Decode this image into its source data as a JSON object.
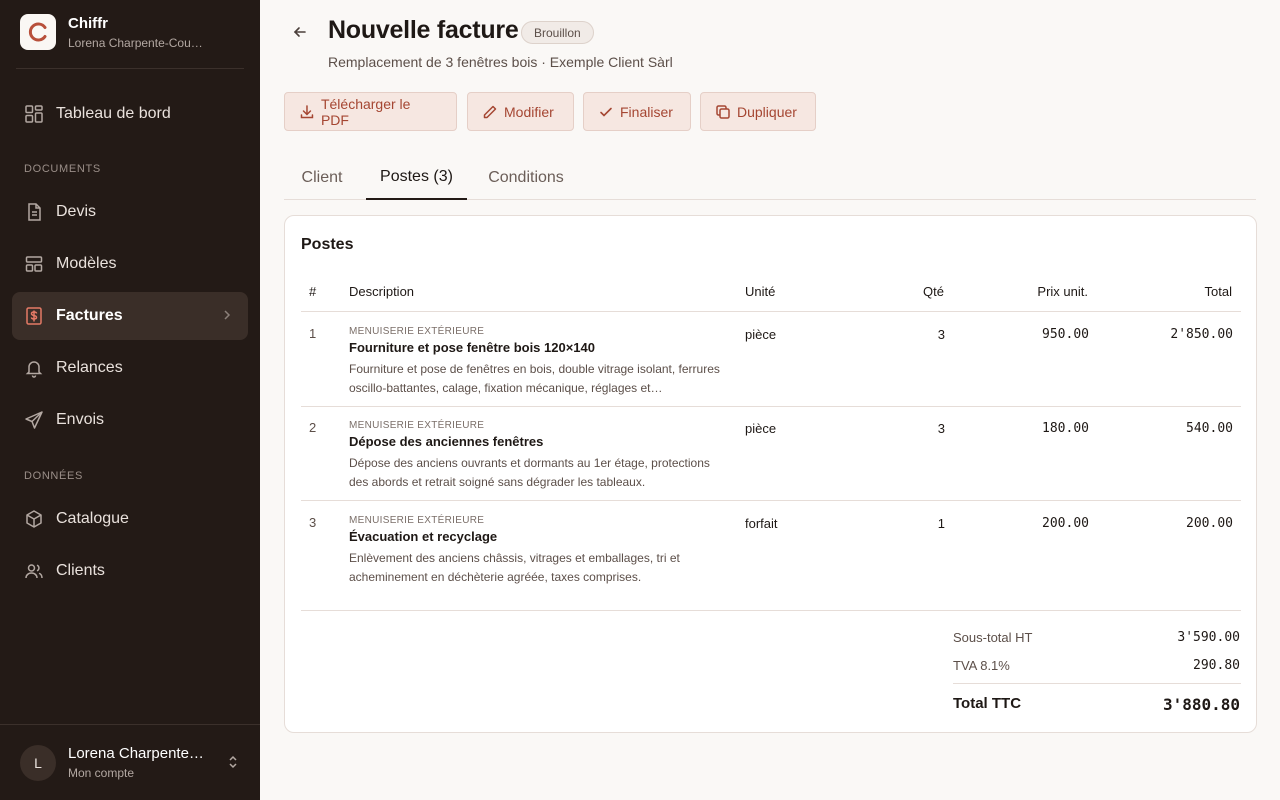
{
  "brand": {
    "name": "Chiffr",
    "subtitle": "Lorena Charpente-Couve…"
  },
  "sidebar": {
    "dashboard": "Tableau de bord",
    "section_documents": "DOCUMENTS",
    "devis": "Devis",
    "modeles": "Modèles",
    "factures": "Factures",
    "relances": "Relances",
    "envois": "Envois",
    "section_donnees": "DONNÉES",
    "catalogue": "Catalogue",
    "clients": "Clients"
  },
  "account": {
    "initial": "L",
    "name": "Lorena Charpente…",
    "subtitle": "Mon compte"
  },
  "header": {
    "title": "Nouvelle facture",
    "status": "Brouillon",
    "subtitle": "Remplacement de 3 fenêtres bois · Exemple Client Sàrl"
  },
  "actions": {
    "download": "Télécharger le PDF",
    "edit": "Modifier",
    "finalize": "Finaliser",
    "duplicate": "Dupliquer"
  },
  "tabs": {
    "client": "Client",
    "postes": "Postes (3)",
    "conditions": "Conditions"
  },
  "postes": {
    "title": "Postes",
    "columns": {
      "num": "#",
      "description": "Description",
      "unit": "Unité",
      "qty": "Qté",
      "price": "Prix unit.",
      "total": "Total"
    },
    "rows": [
      {
        "num": "1",
        "category": "MENUISERIE EXTÉRIEURE",
        "title": "Fourniture et pose fenêtre bois 120×140",
        "description": "Fourniture et pose de fenêtres en bois, double vitrage isolant, ferrures oscillo-battantes, calage, fixation mécanique, réglages et…",
        "unit": "pièce",
        "qty": "3",
        "price": "950.00",
        "total": "2'850.00"
      },
      {
        "num": "2",
        "category": "MENUISERIE EXTÉRIEURE",
        "title": "Dépose des anciennes fenêtres",
        "description": "Dépose des anciens ouvrants et dormants au 1er étage, protections des abords et retrait soigné sans dégrader les tableaux.",
        "unit": "pièce",
        "qty": "3",
        "price": "180.00",
        "total": "540.00"
      },
      {
        "num": "3",
        "category": "MENUISERIE EXTÉRIEURE",
        "title": "Évacuation et recyclage",
        "description": "Enlèvement des anciens châssis, vitrages et emballages, tri et acheminement en déchèterie agréée, taxes comprises.",
        "unit": "forfait",
        "qty": "1",
        "price": "200.00",
        "total": "200.00"
      }
    ],
    "subtotal_label": "Sous-total HT",
    "subtotal_value": "3'590.00",
    "vat_label": "TVA 8.1%",
    "vat_value": "290.80",
    "total_label": "Total TTC",
    "total_value": "3'880.80"
  },
  "colors": {
    "sidebar_bg": "#231a16",
    "accent": "#a54632",
    "active_icon": "#e47a66",
    "page_bg": "#faf8f6"
  }
}
